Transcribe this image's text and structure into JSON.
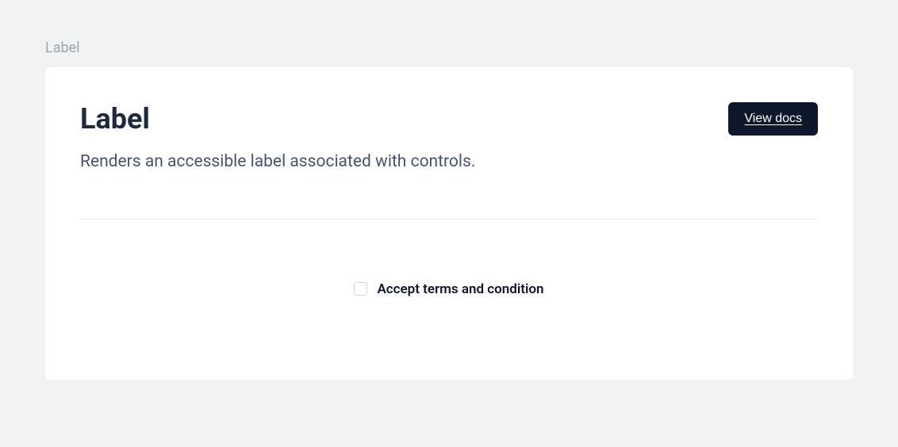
{
  "section": {
    "label": "Label"
  },
  "card": {
    "title": "Label",
    "description": "Renders an accessible label associated with controls.",
    "viewDocsLabel": "View docs"
  },
  "demo": {
    "checkboxLabel": "Accept terms and condition",
    "checkboxChecked": false
  }
}
